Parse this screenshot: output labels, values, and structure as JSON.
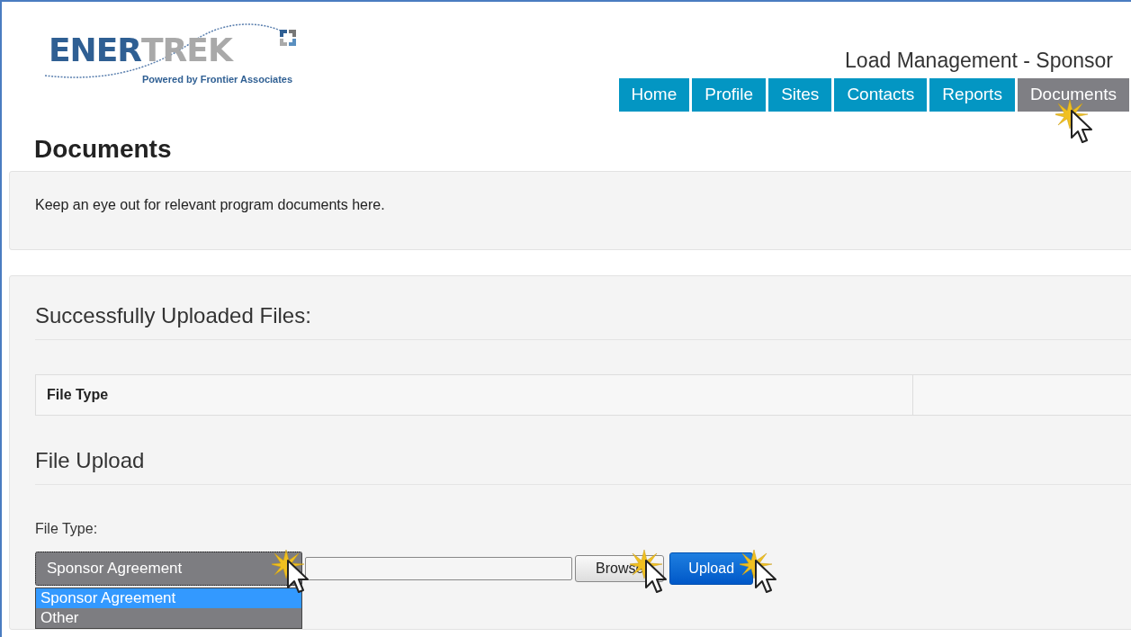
{
  "logo": {
    "word_1": "ENER",
    "word_2": "TREK",
    "tagline": "Powered by Frontier Associates"
  },
  "app_title": "Load Management - Sponsor",
  "tabs": [
    {
      "label": "Home",
      "selected": false,
      "pointer": false
    },
    {
      "label": "Profile",
      "selected": false,
      "pointer": false
    },
    {
      "label": "Sites",
      "selected": false,
      "pointer": false
    },
    {
      "label": "Contacts",
      "selected": false,
      "pointer": false
    },
    {
      "label": "Reports",
      "selected": false,
      "pointer": false
    },
    {
      "label": "Documents",
      "selected": true,
      "pointer": true
    }
  ],
  "page_title": "Documents",
  "intro": "Keep an eye out for relevant program documents here.",
  "uploaded": {
    "heading": "Successfully Uploaded Files:",
    "columns": [
      "File Type"
    ]
  },
  "upload": {
    "heading": "File Upload",
    "field_label": "File Type:",
    "select": {
      "value": "Sponsor Agreement",
      "pointer": true,
      "expanded": true,
      "options": [
        {
          "label": "Sponsor Agreement",
          "selected": true
        },
        {
          "label": "Other",
          "selected": false
        }
      ]
    },
    "browse": {
      "label": "Browse",
      "pointer": true
    },
    "submit": {
      "label": "Upload",
      "pointer": true
    }
  }
}
